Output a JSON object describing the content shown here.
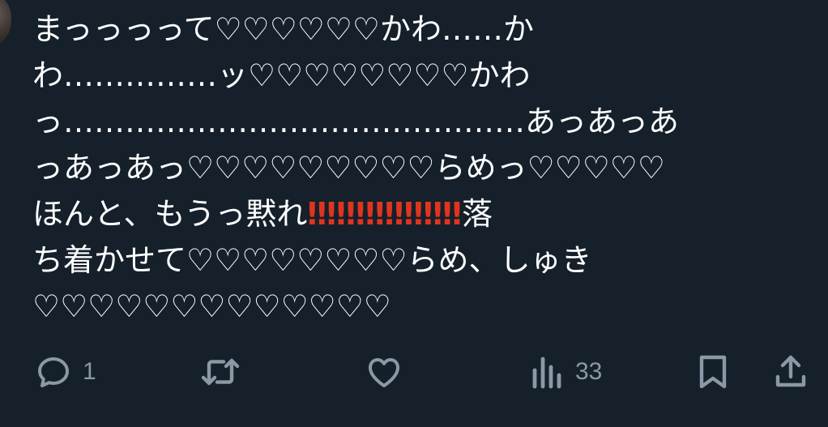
{
  "tweet": {
    "lines": [
      "まっっっって♡♡♡♡♡♡かわ……か",
      "わ……………ッ♡♡♡♡♡♡♡♡かわ",
      "っ………………………………………あっあっあ",
      "っあっあっ♡♡♡♡♡♡♡♡♡らめっ♡♡♡♡♡"
    ],
    "line5_text": "ほんと、もうっ黙れ",
    "line5_marks": [
      "‼",
      "‼",
      "‼",
      "‼",
      "‼",
      "‼",
      "‼",
      "‼"
    ],
    "line5_tail": "落",
    "line6": "ち着かせて♡♡♡♡♡♡♡♡らめ、しゅき",
    "line7": "♡♡♡♡♡♡♡♡♡♡♡♡♡"
  },
  "actions": {
    "reply_count": "1",
    "views_count": "33",
    "icons": [
      "reply-icon",
      "retweet-icon",
      "like-icon",
      "views-icon",
      "bookmark-icon",
      "share-icon"
    ]
  },
  "colors": {
    "background": "#15202b",
    "text": "#ffffff",
    "muted": "#8b98a5",
    "warning": "#e0341e"
  }
}
